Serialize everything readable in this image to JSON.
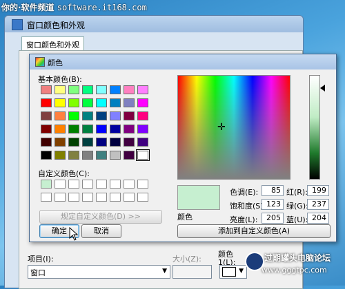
{
  "watermark": {
    "text": "你的·软件频道",
    "domain": "software.it168.com"
  },
  "bg_window": {
    "title": "窗口颜色和外观",
    "tab": "窗口颜色和外观",
    "item_label": "项目(I):",
    "item_value": "窗口",
    "size_label": "大小(Z):",
    "color1_label": "颜色 1(L):"
  },
  "dialog": {
    "title": "颜色",
    "basic_colors_label": "基本颜色(B):",
    "custom_colors_label": "自定义颜色(C):",
    "define_custom_button": "规定自定义颜色(D) >>",
    "ok_button": "确定",
    "cancel_button": "取消",
    "color_label": "颜色",
    "hue_label": "色调(E):",
    "hue": "85",
    "sat_label": "饱和度(S):",
    "sat": "123",
    "lum_label": "亮度(L):",
    "lum": "205",
    "red_label": "红(R):",
    "red": "199",
    "green_label": "绿(G):",
    "green": "237",
    "blue_label": "蓝(U):",
    "blue": "204",
    "add_custom_button": "添加到自定义颜色(A)",
    "basic_colors": [
      [
        "#f08080",
        "#ffff80",
        "#80ff80",
        "#00ff80",
        "#80ffff",
        "#0080ff",
        "#ff80c0",
        "#ff80ff"
      ],
      [
        "#ff0000",
        "#ffff00",
        "#80ff00",
        "#00ff40",
        "#00ffff",
        "#0080c0",
        "#8080c0",
        "#ff00ff"
      ],
      [
        "#804040",
        "#ff8040",
        "#00ff00",
        "#008080",
        "#004080",
        "#8080ff",
        "#800040",
        "#ff0080"
      ],
      [
        "#800000",
        "#ff8000",
        "#008000",
        "#008040",
        "#0000ff",
        "#0000a0",
        "#800080",
        "#8000ff"
      ],
      [
        "#400000",
        "#804000",
        "#004000",
        "#004040",
        "#000080",
        "#000040",
        "#400040",
        "#400080"
      ],
      [
        "#000000",
        "#808000",
        "#808040",
        "#808080",
        "#408080",
        "#c0c0c0",
        "#400040",
        "#ffffff"
      ]
    ],
    "custom_colors": [
      "#c6efd0",
      "#ffffff",
      "#ffffff",
      "#ffffff",
      "#ffffff",
      "#ffffff",
      "#ffffff",
      "#ffffff",
      "#ffffff",
      "#ffffff",
      "#ffffff",
      "#ffffff",
      "#ffffff",
      "#ffffff",
      "#ffffff",
      "#ffffff"
    ],
    "selected_color": "#c6efd0"
  },
  "logo": {
    "text": "过期罐头电脑论坛",
    "url": "www.gggtpc.com"
  }
}
